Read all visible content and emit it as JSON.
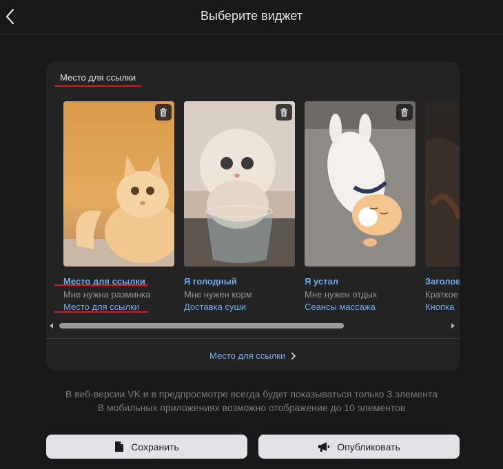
{
  "header": {
    "title": "Выберите виджет",
    "back_icon": "chevron-left-icon"
  },
  "panel": {
    "header_label": "Место для ссылки",
    "footer_link": "Место для ссылки"
  },
  "cards": [
    {
      "title": "Место для ссылки",
      "description": "Мне нужна разминка",
      "link": "Место для ссылки",
      "image": "ginger-kitten-photo"
    },
    {
      "title": "Я голодный",
      "description": "Мне нужен корм",
      "link": "Доставка суши",
      "image": "fluffy-kitten-in-glass-photo"
    },
    {
      "title": "Я устал",
      "description": "Мне нужен отдых",
      "link": "Сеансы массажа",
      "image": "sleeping-kitten-photo"
    },
    {
      "title": "Заголов",
      "description": "Краткое",
      "link": "Кнопка",
      "image": "dark-photo"
    }
  ],
  "notes": [
    "В веб-версии VK и в предпросмотре всегда будет показываться только 3 элемента",
    "В мобильных приложениях возможно отображение до 10 элементов"
  ],
  "buttons": {
    "save": "Сохранить",
    "publish": "Опубликовать"
  },
  "colors": {
    "background": "#19191a",
    "panel": "#232324",
    "link": "#71aaeb",
    "highlight": "#e0161e",
    "button": "#e1e3e6"
  }
}
